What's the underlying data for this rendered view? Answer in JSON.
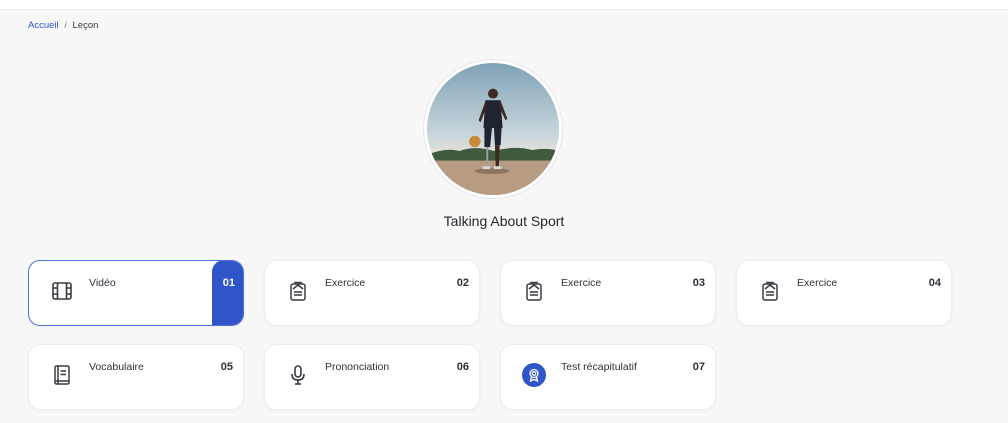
{
  "breadcrumb": {
    "home": "Accueil",
    "separator": "/",
    "current": "Leçon"
  },
  "lesson": {
    "title": "Talking About Sport"
  },
  "colors": {
    "accent": "#2f55c8",
    "link": "#2a55c8",
    "background": "#f8f8f9"
  },
  "cards": [
    {
      "label": "Vidéo",
      "number": "01",
      "icon": "film-icon",
      "active": true
    },
    {
      "label": "Exercice",
      "number": "02",
      "icon": "clipboard-icon",
      "active": false
    },
    {
      "label": "Exercice",
      "number": "03",
      "icon": "clipboard-icon",
      "active": false
    },
    {
      "label": "Exercice",
      "number": "04",
      "icon": "clipboard-icon",
      "active": false
    },
    {
      "label": "Vocabulaire",
      "number": "05",
      "icon": "book-icon",
      "active": false
    },
    {
      "label": "Prononciation",
      "number": "06",
      "icon": "microphone-icon",
      "active": false
    },
    {
      "label": "Test récapitulatif",
      "number": "07",
      "icon": "award-badge-icon",
      "active": false
    }
  ]
}
